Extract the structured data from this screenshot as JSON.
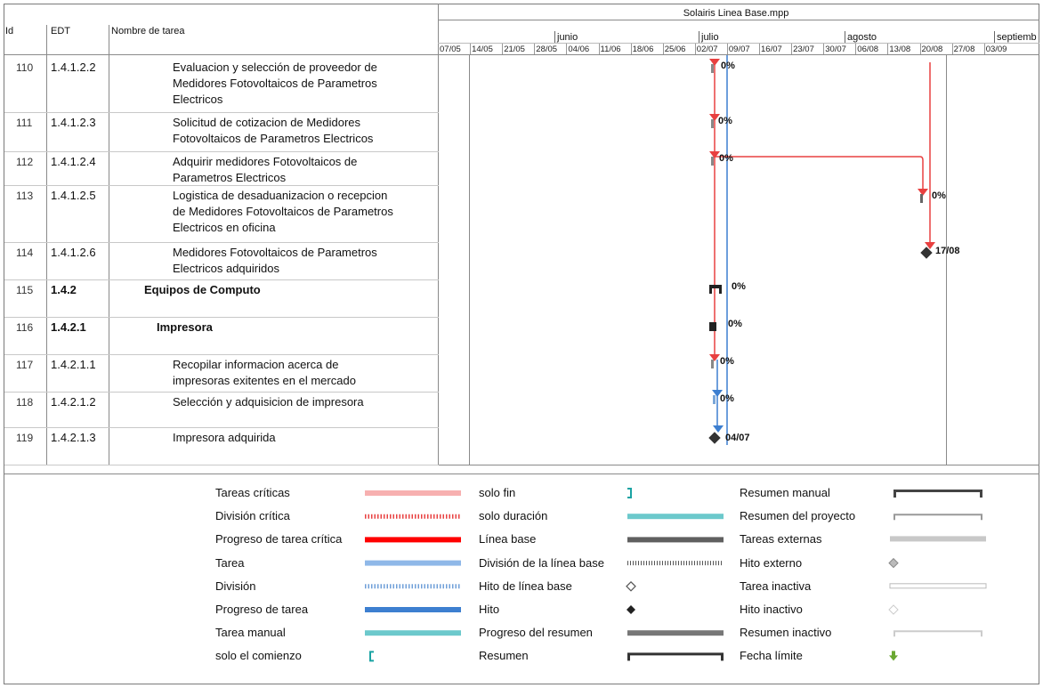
{
  "project_title": "Solairis Linea Base.mpp",
  "columns": {
    "id": "Id",
    "edt": "EDT",
    "name": "Nombre de tarea"
  },
  "timescale": {
    "months": [
      "junio",
      "julio",
      "agosto",
      "septiemb"
    ],
    "weeks": [
      "07/05",
      "14/05",
      "21/05",
      "28/05",
      "04/06",
      "11/06",
      "18/06",
      "25/06",
      "02/07",
      "09/07",
      "16/07",
      "23/07",
      "30/07",
      "06/08",
      "13/08",
      "20/08",
      "27/08",
      "03/09"
    ]
  },
  "rows": [
    {
      "id": "110",
      "edt": "1.4.1.2.2",
      "name_lines": [
        "Evaluacion y selección de proveedor de",
        "Medidores Fotovoltaicos de Parametros",
        "Electricos"
      ],
      "bold": false,
      "gantt_label": "0%"
    },
    {
      "id": "111",
      "edt": "1.4.1.2.3",
      "name_lines": [
        "Solicitud de cotizacion de Medidores",
        "Fotovoltaicos de Parametros Electricos"
      ],
      "bold": false,
      "gantt_label": "0%"
    },
    {
      "id": "112",
      "edt": "1.4.1.2.4",
      "name_lines": [
        "Adquirir medidores Fotovoltaicos de",
        "Parametros Electricos"
      ],
      "bold": false,
      "gantt_label": "0%"
    },
    {
      "id": "113",
      "edt": "1.4.1.2.5",
      "name_lines": [
        "Logistica de desaduanizacion o recepcion",
        "de Medidores Fotovoltaicos de Parametros",
        "Electricos en oficina"
      ],
      "bold": false,
      "gantt_label": "0%"
    },
    {
      "id": "114",
      "edt": "1.4.1.2.6",
      "name_lines": [
        "Medidores Fotovoltaicos de Parametros",
        "Electricos adquiridos"
      ],
      "bold": false,
      "gantt_label": "17/08"
    },
    {
      "id": "115",
      "edt": "1.4.2",
      "name_lines": [
        "Equipos de Computo"
      ],
      "bold": true,
      "gantt_label": "0%"
    },
    {
      "id": "116",
      "edt": "1.4.2.1",
      "name_lines": [
        "Impresora"
      ],
      "bold": true,
      "gantt_label": "0%"
    },
    {
      "id": "117",
      "edt": "1.4.2.1.1",
      "name_lines": [
        "Recopilar informacion acerca de",
        "impresoras exitentes en el mercado"
      ],
      "bold": false,
      "gantt_label": "0%"
    },
    {
      "id": "118",
      "edt": "1.4.2.1.2",
      "name_lines": [
        "Selección y adquisicion de impresora"
      ],
      "bold": false,
      "gantt_label": "0%"
    },
    {
      "id": "119",
      "edt": "1.4.2.1.3",
      "name_lines": [
        "Impresora adquirida"
      ],
      "bold": false,
      "gantt_label": "04/07"
    }
  ],
  "legend": [
    {
      "label": "Tareas críticas",
      "swatch": "critical-task"
    },
    {
      "label": "División crítica",
      "swatch": "critical-split"
    },
    {
      "label": "Progreso de tarea crítica",
      "swatch": "critical-progress"
    },
    {
      "label": "Tarea",
      "swatch": "task"
    },
    {
      "label": "División",
      "swatch": "split"
    },
    {
      "label": "Progreso de tarea",
      "swatch": "task-progress"
    },
    {
      "label": "Tarea manual",
      "swatch": "manual-task"
    },
    {
      "label": "solo el comienzo",
      "swatch": "start-only"
    },
    {
      "label": "solo fin",
      "swatch": "finish-only"
    },
    {
      "label": "solo duración",
      "swatch": "duration-only"
    },
    {
      "label": "Línea base",
      "swatch": "baseline"
    },
    {
      "label": "División de la línea base",
      "swatch": "baseline-split"
    },
    {
      "label": "Hito de línea base",
      "swatch": "baseline-milestone"
    },
    {
      "label": "Hito",
      "swatch": "milestone"
    },
    {
      "label": "Progreso del resumen",
      "swatch": "summary-progress"
    },
    {
      "label": "Resumen",
      "swatch": "summary"
    },
    {
      "label": "Resumen manual",
      "swatch": "manual-summary"
    },
    {
      "label": "Resumen del proyecto",
      "swatch": "project-summary"
    },
    {
      "label": "Tareas externas",
      "swatch": "external-tasks"
    },
    {
      "label": "Hito externo",
      "swatch": "external-milestone"
    },
    {
      "label": "Tarea inactiva",
      "swatch": "inactive-task"
    },
    {
      "label": "Hito inactivo",
      "swatch": "inactive-milestone"
    },
    {
      "label": "Resumen inactivo",
      "swatch": "inactive-summary"
    },
    {
      "label": "Fecha límite",
      "swatch": "deadline"
    }
  ],
  "colors": {
    "critical": "#e84040",
    "critical_light": "#f7b0b0",
    "task": "#8fb8e8",
    "task_progress": "#3d7fd0",
    "manual": "#6cc9cc",
    "baseline": "#606060",
    "deadline": "#6aa832"
  }
}
